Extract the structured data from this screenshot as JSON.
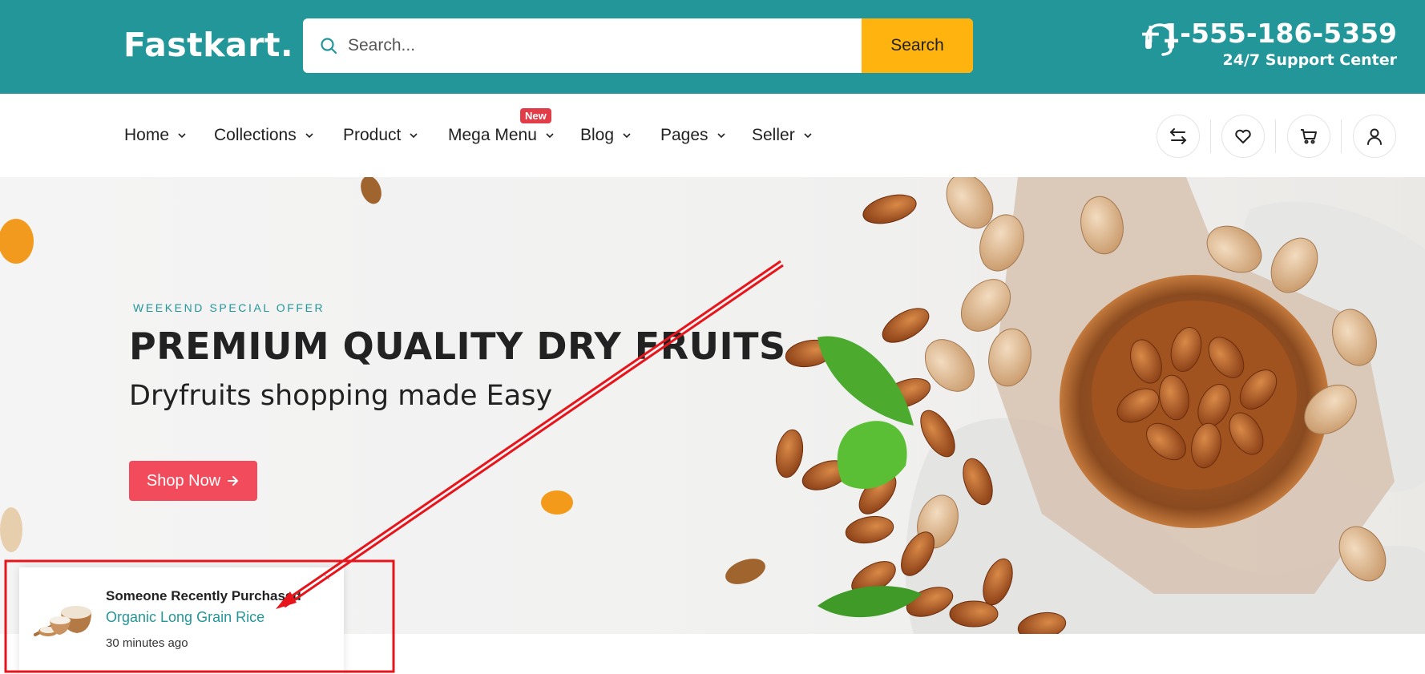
{
  "header": {
    "logo": "Fastkart.",
    "search": {
      "placeholder": "Search...",
      "button_label": "Search"
    },
    "contact": {
      "phone": "+1-555-186-5359",
      "support_label": "24/7 Support Center"
    },
    "colors": {
      "brand": "#23969a",
      "search_button": "#ffb30f"
    }
  },
  "nav": {
    "items": [
      {
        "label": "Home"
      },
      {
        "label": "Collections"
      },
      {
        "label": "Product"
      },
      {
        "label": "Mega Menu",
        "badge": "New"
      },
      {
        "label": "Blog"
      },
      {
        "label": "Pages"
      },
      {
        "label": "Seller"
      }
    ],
    "icons": [
      "compare-icon",
      "heart-icon",
      "cart-icon",
      "user-icon"
    ]
  },
  "hero": {
    "tag": "WEEKEND SPECIAL OFFER",
    "title": "PREMIUM QUALITY DRY FRUITS",
    "subtitle": "Dryfruits shopping made Easy",
    "button_label": "Shop Now",
    "button_color": "#f24b5c"
  },
  "popup": {
    "heading": "Someone Recently Purchased",
    "product": "Organic Long Grain Rice",
    "time": "30 minutes ago"
  },
  "annotation": {
    "color": "#e8141b"
  }
}
